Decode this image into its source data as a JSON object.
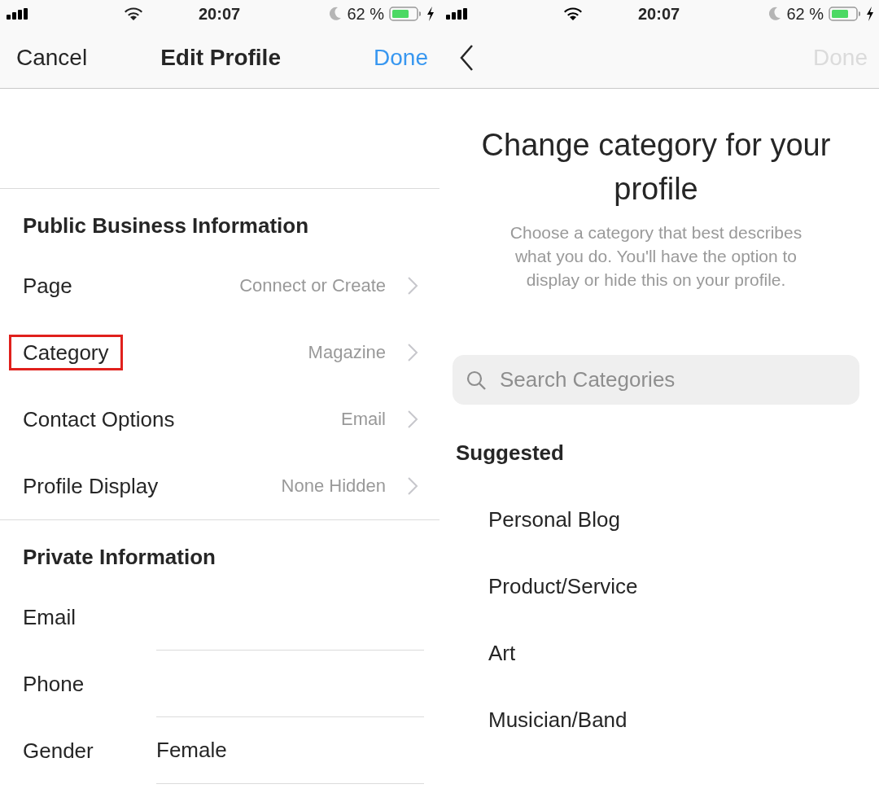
{
  "screens": [
    {
      "status_bar": {
        "time": "20:07",
        "battery": "62 %"
      },
      "nav": {
        "left": "Cancel",
        "title": "Edit Profile",
        "right": "Done",
        "right_enabled": true
      },
      "sections": [
        {
          "header": "Public Business Information",
          "rows": [
            {
              "kind": "link",
              "label": "Page",
              "value": "Connect or Create",
              "highlighted": false
            },
            {
              "kind": "link",
              "label": "Category",
              "value": "Magazine",
              "highlighted": true
            },
            {
              "kind": "link",
              "label": "Contact Options",
              "value": "Email",
              "highlighted": false
            },
            {
              "kind": "link",
              "label": "Profile Display",
              "value": "None Hidden",
              "highlighted": false
            }
          ]
        },
        {
          "header": "Private Information",
          "rows": [
            {
              "kind": "field",
              "label": "Email",
              "highlighted": false
            },
            {
              "kind": "field",
              "label": "Phone",
              "highlighted": false
            },
            {
              "kind": "field",
              "label": "Gender",
              "value": "Female",
              "highlighted": false
            }
          ]
        }
      ]
    },
    {
      "status_bar": {
        "time": "20:07",
        "battery": "62 %"
      },
      "nav": {
        "right": "Done",
        "right_enabled": false
      },
      "heading": "Change category for your profile",
      "description": "Choose a category that best describes what you do. You'll have the option to display or hide this on your profile.",
      "search": {
        "placeholder": "Search Categories"
      },
      "suggested_header": "Suggested",
      "categories": [
        "Personal Blog",
        "Product/Service",
        "Art",
        "Musician/Band"
      ]
    }
  ]
}
